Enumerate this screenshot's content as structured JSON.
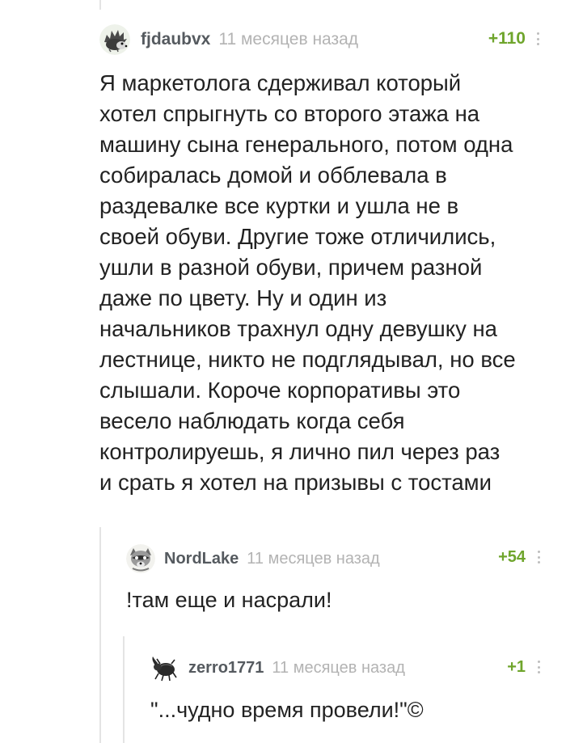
{
  "comments": [
    {
      "username": "fjdaubvx",
      "time": "11 месяцев назад",
      "rating": "+110",
      "avatar_icon": "hedgehog-avatar-icon",
      "text": "Я маркетолога сдерживал который\nхотел спрыгнуть со второго этажа на\nмашину сына генерального, потом одна\nсобиралась домой и обблевала в\nраздевалке все куртки и ушла не в\nсвоей обуви. Другие тоже отличились,\nушли в разной обуви, причем разной\nдаже по цвету. Ну и один из\nначальников трахнул одну девушку на\nлестнице, никто не подглядывал, но все\nслышали. Короче корпоративы это\nвесело наблюдать когда себя\nконтролируешь, я лично пил через раз\nи срать я хотел на призывы с тостами"
    },
    {
      "username": "NordLake",
      "time": "11 месяцев назад",
      "rating": "+54",
      "avatar_icon": "raccoon-avatar-icon",
      "text": "!там еще и насрали!"
    },
    {
      "username": "zerro1771",
      "time": "11 месяцев назад",
      "rating": "+1",
      "avatar_icon": "rhino-beetle-avatar-icon",
      "text": "\"...чудно время провели!\"©"
    }
  ],
  "colors": {
    "rating": "#6fa52c",
    "username": "#555a5f",
    "time": "#b3b3b3",
    "thread_line": "#e4e4e4"
  }
}
